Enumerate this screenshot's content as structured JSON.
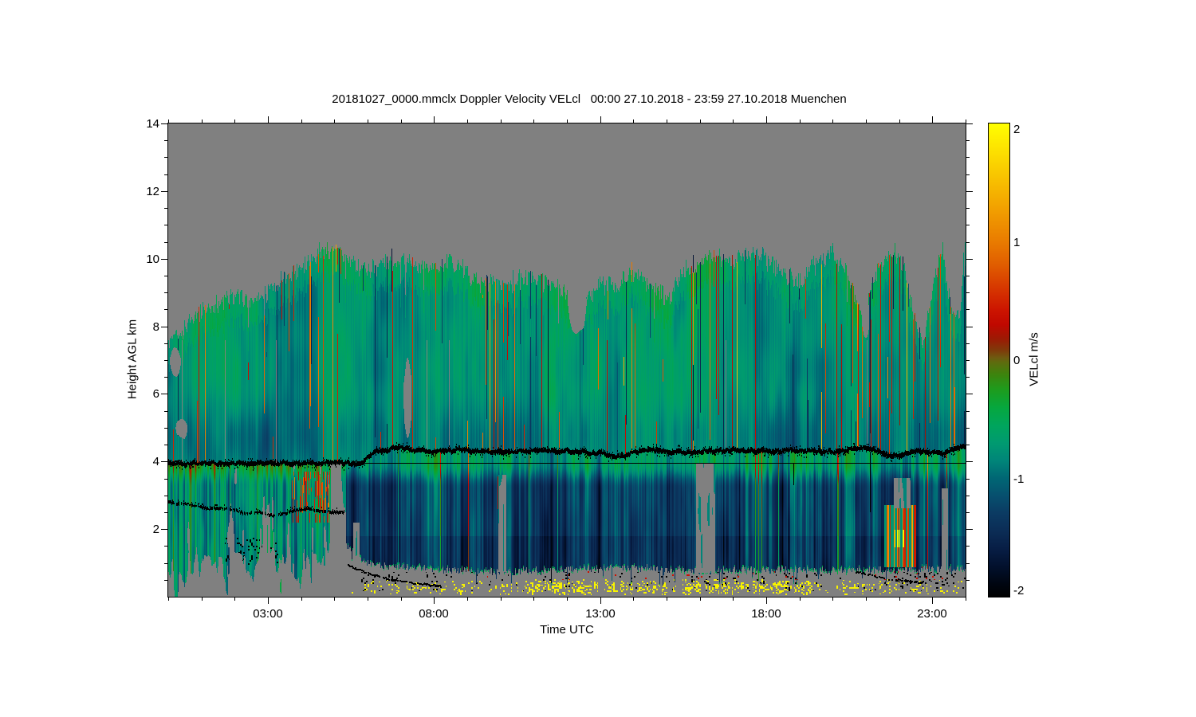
{
  "title": "20181027_0000.mmclx Doppler Velocity VELcl   00:00 27.10.2018 - 23:59 27.10.2018 Muenchen",
  "figure": {
    "xlabel": "Time UTC",
    "ylabel": "Height AGL km",
    "nodata_color": "#808080",
    "frame_color": "#000000",
    "x_range_hours": [
      0,
      24
    ],
    "y_range_km": [
      0,
      14
    ],
    "x_major_ticks": [
      {
        "t": 3,
        "label": "03:00"
      },
      {
        "t": 8,
        "label": "08:00"
      },
      {
        "t": 13,
        "label": "13:00"
      },
      {
        "t": 18,
        "label": "18:00"
      },
      {
        "t": 23,
        "label": "23:00"
      }
    ],
    "x_minor_step_hours": 1,
    "y_major_ticks": [
      {
        "h": 2,
        "label": "2"
      },
      {
        "h": 4,
        "label": "4"
      },
      {
        "h": 6,
        "label": "6"
      },
      {
        "h": 8,
        "label": "8"
      },
      {
        "h": 10,
        "label": "10"
      },
      {
        "h": 12,
        "label": "12"
      },
      {
        "h": 14,
        "label": "14"
      }
    ],
    "y_minor_step_km": 0.5
  },
  "colorbar": {
    "label": "VELcl m/s",
    "range": [
      -2,
      2
    ],
    "ticks": [
      {
        "v": 2,
        "label": "2"
      },
      {
        "v": 1,
        "label": "1"
      },
      {
        "v": 0,
        "label": "0"
      },
      {
        "v": -1,
        "label": "-1"
      },
      {
        "v": -2,
        "label": "-2"
      }
    ],
    "stops": [
      [
        -2.0,
        "#000000"
      ],
      [
        -1.9,
        "#00050f"
      ],
      [
        -1.75,
        "#02102c"
      ],
      [
        -1.6,
        "#071d44"
      ],
      [
        -1.45,
        "#0b2c55"
      ],
      [
        -1.3,
        "#0b3a62"
      ],
      [
        -1.15,
        "#074f6e"
      ],
      [
        -1.0,
        "#006674"
      ],
      [
        -0.85,
        "#008579"
      ],
      [
        -0.7,
        "#009a70"
      ],
      [
        -0.55,
        "#00a55c"
      ],
      [
        -0.4,
        "#06a73e"
      ],
      [
        -0.25,
        "#1d9c1d"
      ],
      [
        -0.12,
        "#3d830d"
      ],
      [
        -0.02,
        "#5e6c0e"
      ],
      [
        0.02,
        "#6e5a10"
      ],
      [
        0.08,
        "#7e3b0a"
      ],
      [
        0.18,
        "#9c1a04"
      ],
      [
        0.3,
        "#c00800"
      ],
      [
        0.42,
        "#cc1400"
      ],
      [
        0.6,
        "#d63500"
      ],
      [
        0.8,
        "#e05c00"
      ],
      [
        1.0,
        "#e97b00"
      ],
      [
        1.25,
        "#f19c00"
      ],
      [
        1.5,
        "#f7bd00"
      ],
      [
        1.75,
        "#fcde00"
      ],
      [
        2.0,
        "#ffff00"
      ]
    ]
  },
  "chart_data": {
    "type": "heatmap",
    "title": "20181027_0000.mmclx Doppler Velocity VELcl   00:00 27.10.2018 - 23:59 27.10.2018 Muenchen",
    "xlabel": "Time UTC",
    "ylabel": "Height AGL km",
    "value_label": "VELcl m/s",
    "value_range": [
      -2,
      2
    ],
    "x_range_hours": [
      0,
      24
    ],
    "y_range_km": [
      0,
      14
    ],
    "description": "Cloud radar Doppler velocity time-height quicklook. Green cloud layer (~-0.3 to -0.7 m/s) from ~4 km up to a ragged 7.5-10.5 km cloud top; dark navy precipitation band (-1 to -2 m/s) below the 4 km melting layer down to ~0.8 km; gray = no data; yellow/black ground clutter speckles below 0.6 km; thick black melting-layer scribble near 4-4.3 km plus a thin straight reference line at 3.95 km; second black scribble line near 2.4-2.8 km before 05:20.",
    "profiles": {
      "cloud_top_km": {
        "t": [
          0,
          0.3,
          0.8,
          1.3,
          2,
          2.5,
          3,
          3.5,
          4,
          4.5,
          5,
          5.4,
          6,
          6.5,
          7,
          7.5,
          8,
          8.5,
          9,
          9.5,
          10,
          10.5,
          11,
          11.5,
          12,
          12.3,
          12.6,
          13,
          13.5,
          14,
          14.5,
          15,
          15.5,
          16,
          16.5,
          17,
          17.5,
          18,
          18.5,
          19,
          19.5,
          20,
          20.5,
          20.9,
          21.1,
          21.4,
          21.8,
          22.1,
          22.45,
          22.7,
          23,
          23.3,
          23.55,
          23.8,
          24
        ],
        "h": [
          7.5,
          7.7,
          8.4,
          8.6,
          8.9,
          8.7,
          9.1,
          9.4,
          9.8,
          10.2,
          10.3,
          9.9,
          9.7,
          9.9,
          10.0,
          9.7,
          9.8,
          9.9,
          9.6,
          9.3,
          9.2,
          9.4,
          9.5,
          9.3,
          8.9,
          8.5,
          8.8,
          9.3,
          9.2,
          9.6,
          9.2,
          8.8,
          9.6,
          9.9,
          10.1,
          9.9,
          10.2,
          10.0,
          9.6,
          9.3,
          9.9,
          10.1,
          9.4,
          8.1,
          9.0,
          9.8,
          10.2,
          9.9,
          8.3,
          7.5,
          9.2,
          10.2,
          8.6,
          8.2,
          10.9
        ]
      },
      "melting_layer_line_km": {
        "t": [
          0,
          5.75,
          5.95,
          6.2,
          6.5,
          7.0,
          7.5,
          8,
          9,
          10,
          11,
          12,
          13,
          13.6,
          14,
          14.5,
          15,
          15.7,
          16.3,
          17,
          18,
          19,
          20,
          20.8,
          21.4,
          21.75,
          22,
          22.3,
          23,
          23.3,
          23.7,
          24
        ],
        "h": [
          3.95,
          3.95,
          4.05,
          4.26,
          4.33,
          4.42,
          4.32,
          4.3,
          4.33,
          4.26,
          4.32,
          4.3,
          4.24,
          4.14,
          4.28,
          4.33,
          4.3,
          4.26,
          4.3,
          4.33,
          4.3,
          4.33,
          4.28,
          4.38,
          4.33,
          4.12,
          4.2,
          4.3,
          4.28,
          4.24,
          4.4,
          4.45
        ]
      },
      "lower_black_line_km": {
        "t": [
          0,
          0.7,
          1.2,
          1.8,
          2.3,
          2.7,
          3.2,
          3.7,
          4.2,
          4.7,
          5.3
        ],
        "h": [
          2.78,
          2.72,
          2.6,
          2.62,
          2.45,
          2.5,
          2.38,
          2.52,
          2.6,
          2.52,
          2.48
        ]
      },
      "rain_band_bottom_km": {
        "t": [
          5.35,
          5.8,
          6.5,
          8,
          10,
          12,
          14,
          16,
          18,
          20,
          22,
          24
        ],
        "h": [
          1.5,
          1.05,
          0.9,
          0.82,
          0.72,
          0.8,
          0.85,
          0.75,
          0.8,
          0.75,
          0.8,
          0.78
        ]
      },
      "thin_reference_line_km": 3.95
    },
    "features": {
      "updraft_red_streak_windows_h": [
        [
          0.4,
          1.2
        ],
        [
          3.8,
          5.7
        ],
        [
          6.7,
          7.45
        ],
        [
          9.5,
          10.5
        ],
        [
          11.2,
          11.7
        ],
        [
          13.8,
          14.4
        ],
        [
          15.4,
          17.7
        ],
        [
          19.3,
          20.4
        ],
        [
          20.7,
          24
        ]
      ],
      "green_shaft_windows_h": [
        [
          8.35,
          9.15
        ],
        [
          13.05,
          13.65
        ],
        [
          14.55,
          15.3
        ],
        [
          17.2,
          17.9
        ],
        [
          22.55,
          23.15
        ]
      ],
      "gray_slots": [
        {
          "t": [
            15.88,
            16.45
          ],
          "h": [
            0.7,
            3.95
          ]
        },
        {
          "t": [
            9.92,
            10.16
          ],
          "h": [
            0.72,
            3.6
          ]
        },
        {
          "t": [
            23.28,
            23.46
          ],
          "h": [
            0.7,
            3.2
          ]
        },
        {
          "t": [
            21.82,
            22.34
          ],
          "h": [
            2.62,
            3.5
          ]
        },
        {
          "t": [
            5.55,
            5.75
          ],
          "h": [
            0.7,
            2.2
          ]
        }
      ],
      "gray_holes_upper": [
        {
          "t": [
            12.0,
            12.6
          ],
          "h": [
            7.7,
            9.5
          ]
        },
        {
          "t": [
            0.02,
            0.38
          ],
          "h": [
            6.5,
            7.45
          ]
        },
        {
          "t": [
            0.2,
            0.6
          ],
          "h": [
            4.65,
            5.3
          ]
        },
        {
          "t": [
            7.05,
            7.32
          ],
          "h": [
            4.5,
            7.2
          ]
        },
        {
          "t": [
            20.85,
            21.12
          ],
          "h": [
            7.6,
            8.9
          ]
        }
      ],
      "red_speckle_blob": {
        "t": [
          3.7,
          4.9
        ],
        "h": [
          2.2,
          3.7
        ]
      },
      "red_updraft_feature": {
        "t": [
          21.55,
          22.5
        ],
        "h": [
          0.88,
          2.7
        ],
        "core": {
          "t": [
            21.86,
            22.14
          ],
          "h": [
            1.45,
            1.98
          ]
        }
      },
      "mid_red_fleck_windows_h": [
        [
          9.9,
          10.3
        ],
        [
          12.0,
          12.4
        ],
        [
          14.6,
          15.25
        ],
        [
          19.0,
          19.4
        ]
      ],
      "black_vertical_strands": [
        [
          21.12,
          2.5,
          4.28
        ],
        [
          18.82,
          3.3,
          3.97
        ]
      ],
      "black_speckle_clusters": [
        [
          1.7,
          3.3,
          0.85,
          1.75
        ],
        [
          10.4,
          11.35,
          1.0,
          1.6
        ]
      ]
    },
    "clutter": {
      "yellow_color": "#f8f400",
      "red_color": "#cc1000",
      "yellow_band_h_km": [
        0.05,
        0.52
      ],
      "yellow_dense_windows_h": [
        [
          10.7,
          19.35
        ]
      ],
      "yellow_sparse_windows_h": [
        [
          5.85,
          10.7
        ],
        [
          19.35,
          24
        ]
      ],
      "black_dense_windows_h": [
        [
          5.4,
          8.3
        ],
        [
          10.4,
          13.3
        ],
        [
          15.8,
          18.7
        ],
        [
          20.3,
          24
        ]
      ],
      "red_dot_windows_h": [
        [
          8,
          9.6
        ],
        [
          11.3,
          19
        ],
        [
          20,
          23.6
        ]
      ],
      "descending_curves": [
        {
          "t": [
            5.4,
            6.0,
            6.8,
            8.2
          ],
          "h": [
            0.95,
            0.7,
            0.5,
            0.33
          ]
        },
        {
          "t": [
            20.7,
            21.6,
            22.8
          ],
          "h": [
            0.75,
            0.55,
            0.42
          ]
        }
      ]
    }
  }
}
